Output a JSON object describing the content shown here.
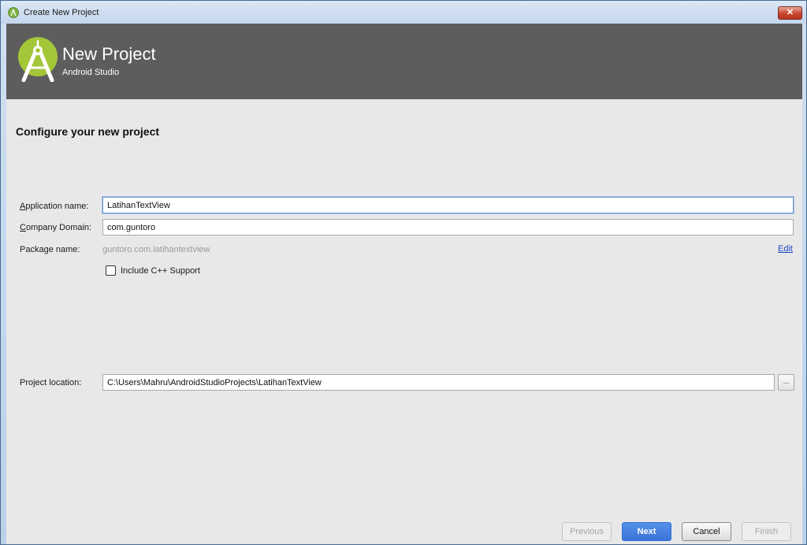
{
  "window": {
    "title": "Create New Project",
    "close_glyph": "✕"
  },
  "header": {
    "title": "New Project",
    "subtitle": "Android Studio",
    "logo_icon": "android-studio-logo-icon"
  },
  "page": {
    "section_title": "Configure your new project"
  },
  "form": {
    "app_name": {
      "label_mnemonic": "A",
      "label_rest": "pplication name:",
      "value": "LatihanTextView"
    },
    "company_domain": {
      "label_mnemonic": "C",
      "label_rest": "ompany Domain:",
      "value": "com.guntoro"
    },
    "package_name": {
      "label": "Package name:",
      "value": "guntoro.com.latihantextview",
      "edit_label": "Edit"
    },
    "cpp_support": {
      "label": "Include C++ Support",
      "checked": false
    },
    "project_location": {
      "label": "Project location:",
      "value": "C:\\Users\\Mahru\\AndroidStudioProjects\\LatihanTextView",
      "browse_label": "..."
    }
  },
  "buttons": {
    "previous": "Previous",
    "next": "Next",
    "cancel": "Cancel",
    "finish": "Finish"
  },
  "colors": {
    "header_bg": "#5d5d5d",
    "body_bg": "#e8e8e8",
    "logo_green": "#a4c639",
    "primary_button": "#3a74d8",
    "link": "#1d45c7"
  }
}
